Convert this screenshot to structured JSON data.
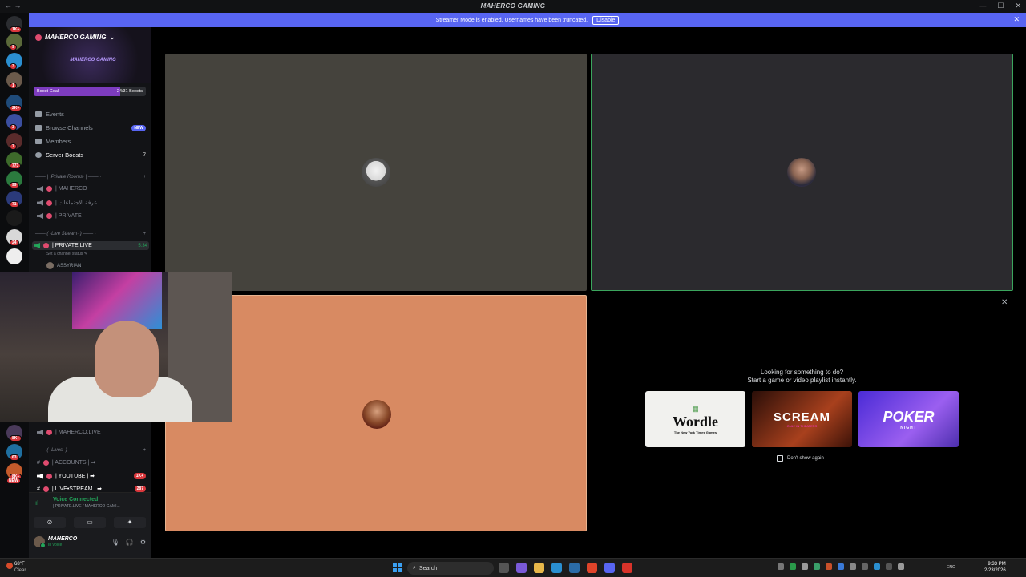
{
  "window": {
    "title": "MAHERCO GAMING",
    "controls": [
      "—",
      "☐",
      "✕"
    ]
  },
  "banner": {
    "text": "Streamer Mode is enabled. Usernames have been truncated.",
    "disable_label": "Disable",
    "close": "✕"
  },
  "server_rail": {
    "badges": [
      "1K+",
      "9",
      "3",
      "1",
      "2K+",
      "3",
      "7",
      "773",
      "99",
      "71",
      "24",
      "8K+",
      "63",
      "8K+",
      "NEW"
    ]
  },
  "server": {
    "name": "MAHERCO GAMING",
    "banner_text": "MAHERCO GAMING",
    "boost_goal_label": "Boost Goal",
    "boost_goal_value": "24/31 Boosts",
    "boost_goal_fraction": 0.77
  },
  "menu": {
    "events": "Events",
    "browse_channels": "Browse Channels",
    "browse_badge": "NEW",
    "members": "Members",
    "server_boosts": "Server Boosts",
    "server_boosts_count": "7"
  },
  "categories": {
    "private_rooms": "─── | ·Private Rooms· | ─── ·",
    "live_stream": "─── ( ·Live Stream· ) ─── ·",
    "lives": "─── ( ·Lives· ) ─── ·"
  },
  "channels": {
    "maherco": "| MAHERCO",
    "meetings": "| غرفة الاجتماعات",
    "private": "| PRIVATE",
    "private_live": "| PRIVATE.LIVE",
    "private_live_time": "5:34",
    "status_placeholder": "Set a channel status ✎",
    "member_name": "ASSYRIAN",
    "maherco_live": "| MAHERCO.LIVE",
    "accounts": "| ACCOUNTS | ➡",
    "youtube": "| YOUTUBE | ➡",
    "youtube_badge": "1K+",
    "live_stream": "| LIVE•STREAM | ➡",
    "live_stream_badge": "287"
  },
  "voice_panel": {
    "title": "Voice Connected",
    "subtitle": "| PRIVATE.LIVE / MAHERCO GAMI...",
    "user_name": "MAHERCO",
    "user_status": "In voice"
  },
  "activity_offer": {
    "line1": "Looking for something to do?",
    "line2": "Start a game or video playlist instantly.",
    "cards": [
      {
        "big": "Wordle",
        "small": "The New York Times Games"
      },
      {
        "big": "SCREAM",
        "small": "ONLY IN THEATERS"
      },
      {
        "big": "POKER",
        "small": "NIGHT"
      }
    ],
    "dont_show": "Don't show again"
  },
  "taskbar": {
    "temperature": "68°F",
    "condition": "Clear",
    "search_placeholder": "Search",
    "language": "ENG",
    "time": "9:33 PM",
    "date": "2/23/2026"
  },
  "colors": {
    "accent": "#5865f2",
    "voice_green": "#23a55a",
    "tile_grey": "#45433d",
    "tile_dark": "#2b2a2e",
    "tile_orange": "#d88a62",
    "speaking_outline": "#3ba55d"
  }
}
